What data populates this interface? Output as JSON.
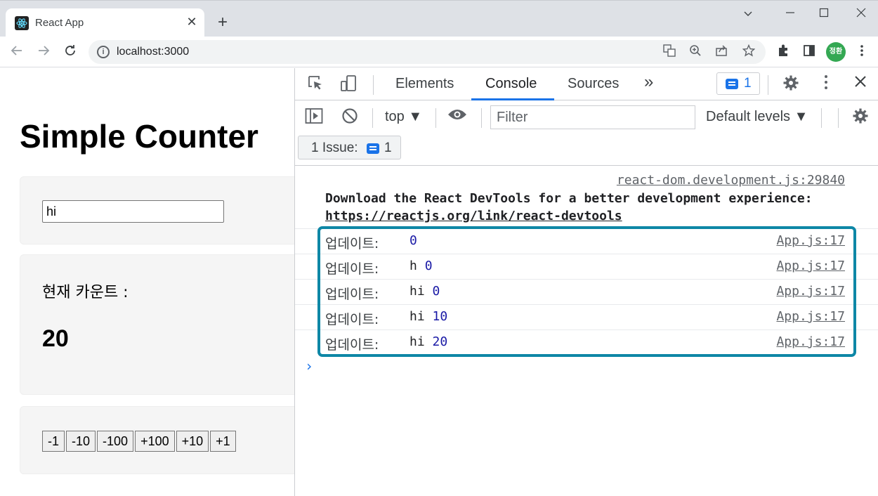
{
  "browser": {
    "tab_title": "React App",
    "tab_close": "✕",
    "new_tab": "+",
    "url": "localhost:3000",
    "avatar_text": "정환"
  },
  "page": {
    "title": "Simple Counter",
    "input_value": "hi",
    "count_label": "현재 카운트 :",
    "count_value": "20",
    "buttons": [
      "-1",
      "-10",
      "-100",
      "+100",
      "+10",
      "+1"
    ]
  },
  "devtools": {
    "tabs": {
      "elements": "Elements",
      "console": "Console",
      "sources": "Sources",
      "more": "»"
    },
    "issue_count": "1",
    "context_select": "top ▼",
    "filter_placeholder": "Filter",
    "levels_select": "Default levels ▼",
    "issue_bar_label": "1 Issue:",
    "issue_bar_count": "1",
    "console": {
      "devtools_source": "react-dom.development.js:29840",
      "devtools_message": "Download the React DevTools for a better development experience:",
      "devtools_link": "https://reactjs.org/link/react-devtools",
      "rows": [
        {
          "label": "업데이트:",
          "text": " ",
          "num": "0",
          "source": "App.js:17"
        },
        {
          "label": "업데이트:",
          "text": "h ",
          "num": "0",
          "source": "App.js:17"
        },
        {
          "label": "업데이트:",
          "text": "hi ",
          "num": "0",
          "source": "App.js:17"
        },
        {
          "label": "업데이트:",
          "text": "hi ",
          "num": "10",
          "source": "App.js:17"
        },
        {
          "label": "업데이트:",
          "text": "hi ",
          "num": "20",
          "source": "App.js:17"
        }
      ],
      "prompt": "›"
    }
  },
  "colors": {
    "highlight_box": "#0e87a6",
    "accent": "#1a73e8"
  }
}
